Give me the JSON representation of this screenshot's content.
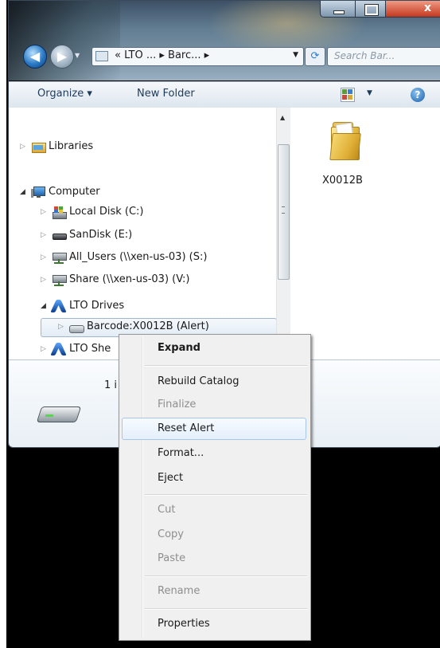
{
  "address_bar": {
    "path_text": "« LTO ... ▸ Barc... ▸"
  },
  "search": {
    "placeholder": "Search Bar..."
  },
  "toolbar": {
    "organize_label": "Organize ▾",
    "new_folder_label": "New Folder"
  },
  "nav_tree": {
    "items": [
      {
        "label": "Libraries",
        "icon": "libraries-icon"
      },
      {
        "label": "Computer",
        "icon": "computer-icon"
      },
      {
        "label": "Local Disk (C:)",
        "icon": "local-disk-icon"
      },
      {
        "label": "SanDisk (E:)",
        "icon": "removable-drive-icon"
      },
      {
        "label": "All_Users (\\\\xen-us-03) (S:)",
        "icon": "network-drive-icon"
      },
      {
        "label": "Share (\\\\xen-us-03) (V:)",
        "icon": "network-drive-icon"
      },
      {
        "label": "LTO Drives",
        "icon": "lto-drives-icon"
      },
      {
        "label": "Barcode:X0012B (Alert)",
        "icon": "tape-drive-icon"
      },
      {
        "label": "LTO She",
        "icon": "lto-shelf-icon"
      }
    ]
  },
  "content": {
    "folder_label": "X0012B"
  },
  "details": {
    "item_count": "1 i"
  },
  "context_menu": {
    "items": [
      {
        "label": "Expand",
        "style": "bold"
      },
      {
        "label": "Rebuild Catalog",
        "style": "normal"
      },
      {
        "label": "Finalize",
        "style": "disabled"
      },
      {
        "label": "Reset Alert",
        "style": "hover"
      },
      {
        "label": "Format...",
        "style": "normal"
      },
      {
        "label": "Eject",
        "style": "normal"
      },
      {
        "label": "Cut",
        "style": "disabled"
      },
      {
        "label": "Copy",
        "style": "disabled"
      },
      {
        "label": "Paste",
        "style": "disabled"
      },
      {
        "label": "Rename",
        "style": "disabled"
      },
      {
        "label": "Properties",
        "style": "normal"
      }
    ]
  },
  "colors": {
    "title_glass": "#627d92",
    "toolbar_text": "#1e3b5c",
    "hover_border": "#a8c6e8",
    "disabled_text": "#8e8e8e"
  }
}
